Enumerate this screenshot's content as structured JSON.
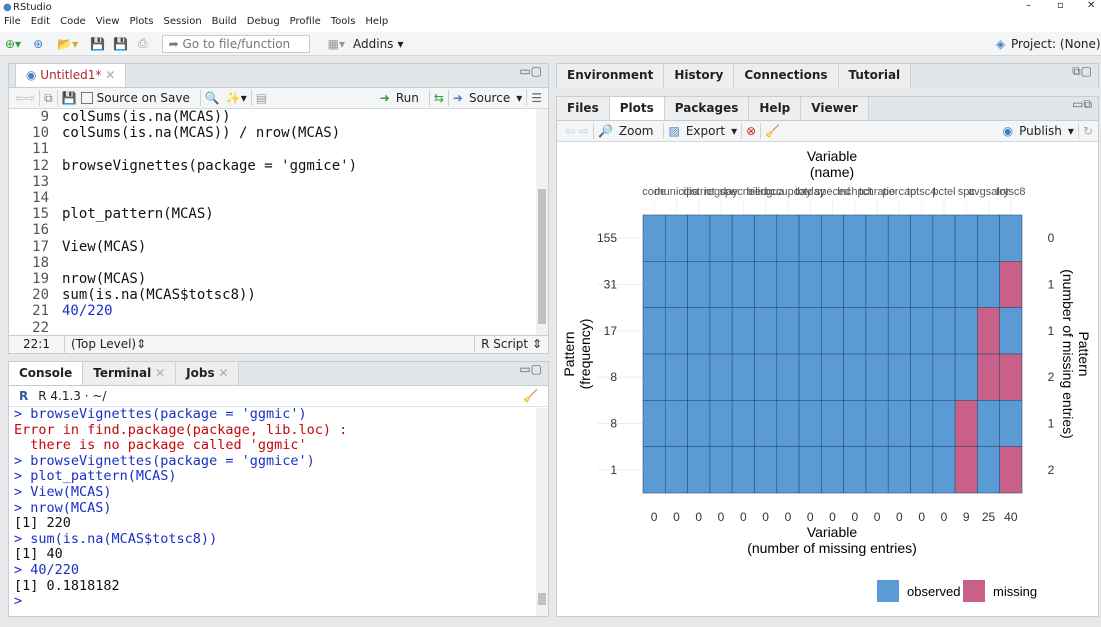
{
  "app": {
    "title": "RStudio"
  },
  "menu": [
    "File",
    "Edit",
    "Code",
    "View",
    "Plots",
    "Session",
    "Build",
    "Debug",
    "Profile",
    "Tools",
    "Help"
  ],
  "toolbar": {
    "goto_placeholder": "Go to file/function",
    "addins": "Addins",
    "project": "Project: (None)"
  },
  "editor": {
    "tab": "Untitled1*",
    "source_on_save": "Source on Save",
    "run": "Run",
    "source": "Source",
    "lines": [
      {
        "n": "9",
        "t": "colSums(is.na(MCAS))"
      },
      {
        "n": "10",
        "t": "colSums(is.na(MCAS)) / nrow(MCAS)"
      },
      {
        "n": "11",
        "t": ""
      },
      {
        "n": "12",
        "t": "browseVignettes(package = 'ggmice')"
      },
      {
        "n": "13",
        "t": ""
      },
      {
        "n": "14",
        "t": ""
      },
      {
        "n": "15",
        "t": "plot_pattern(MCAS)"
      },
      {
        "n": "16",
        "t": ""
      },
      {
        "n": "17",
        "t": "View(MCAS)"
      },
      {
        "n": "18",
        "t": ""
      },
      {
        "n": "19",
        "t": "nrow(MCAS)"
      },
      {
        "n": "20",
        "t": "sum(is.na(MCAS$totsc8))"
      },
      {
        "n": "21",
        "t": "40/220"
      },
      {
        "n": "22",
        "t": ""
      }
    ],
    "status": {
      "pos": "22:1",
      "scope": "(Top Level)",
      "type": "R Script"
    }
  },
  "console": {
    "tabs": [
      "Console",
      "Terminal",
      "Jobs"
    ],
    "version": "R 4.1.3 · ~/",
    "lines": [
      {
        "k": "cmd",
        "t": "> browseVignettes(package = 'ggmic')"
      },
      {
        "k": "err",
        "t": "Error in find.package(package, lib.loc) :"
      },
      {
        "k": "err",
        "t": "  there is no package called 'ggmic'"
      },
      {
        "k": "cmd",
        "t": "> browseVignettes(package = 'ggmice')"
      },
      {
        "k": "cmd",
        "t": "> plot_pattern(MCAS)"
      },
      {
        "k": "cmd",
        "t": "> View(MCAS)"
      },
      {
        "k": "cmd",
        "t": "> nrow(MCAS)"
      },
      {
        "k": "out",
        "t": "[1] 220"
      },
      {
        "k": "cmd",
        "t": "> sum(is.na(MCAS$totsc8))"
      },
      {
        "k": "out",
        "t": "[1] 40"
      },
      {
        "k": "cmd",
        "t": "> 40/220"
      },
      {
        "k": "out",
        "t": "[1] 0.1818182"
      },
      {
        "k": "cmd",
        "t": "> "
      }
    ]
  },
  "env_tabs": [
    "Environment",
    "History",
    "Connections",
    "Tutorial"
  ],
  "files_tabs": [
    "Files",
    "Plots",
    "Packages",
    "Help",
    "Viewer"
  ],
  "plots_toolbar": {
    "zoom": "Zoom",
    "export": "Export",
    "publish": "Publish"
  },
  "chart_data": {
    "type": "heatmap",
    "title": "Variable",
    "subtitle": "(name)",
    "columns": [
      "code",
      "municipa",
      "district",
      "regday",
      "specneed",
      "bilingua",
      "occupday",
      "totday",
      "speced",
      "lnchpct",
      "tchratio",
      "percap",
      "totsc4",
      "pctel",
      "spc",
      "avgsalry",
      "totsc8"
    ],
    "column_missing": [
      0,
      0,
      0,
      0,
      0,
      0,
      0,
      0,
      0,
      0,
      0,
      0,
      0,
      0,
      9,
      25,
      40
    ],
    "rows": [
      {
        "freq": 155,
        "nmiss": 0,
        "missing": []
      },
      {
        "freq": 31,
        "nmiss": 1,
        "missing": [
          "totsc8"
        ]
      },
      {
        "freq": 17,
        "nmiss": 1,
        "missing": [
          "avgsalry"
        ]
      },
      {
        "freq": 8,
        "nmiss": 2,
        "missing": [
          "avgsalry",
          "totsc8"
        ]
      },
      {
        "freq": 8,
        "nmiss": 1,
        "missing": [
          "spc"
        ]
      },
      {
        "freq": 1,
        "nmiss": 2,
        "missing": [
          "spc",
          "totsc8"
        ]
      }
    ],
    "xlabel": "Variable",
    "xlabel2": "(number of missing entries)",
    "ylabel": "Pattern",
    "ylabel2": "(frequency)",
    "ylabel_right": "Pattern",
    "ylabel_right2": "(number of missing entries)",
    "legend": [
      {
        "label": "observed",
        "color": "#5b9bd5"
      },
      {
        "label": "missing",
        "color": "#c8608a"
      }
    ],
    "legend_position": "bottom-right"
  }
}
